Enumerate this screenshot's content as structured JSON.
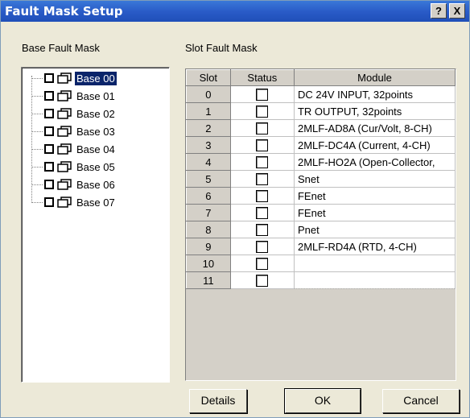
{
  "window": {
    "title": "Fault Mask Setup",
    "help_label": "?",
    "close_label": "X"
  },
  "base_panel": {
    "label": "Base Fault Mask",
    "items": [
      {
        "label": "Base 00",
        "selected": true
      },
      {
        "label": "Base 01",
        "selected": false
      },
      {
        "label": "Base 02",
        "selected": false
      },
      {
        "label": "Base 03",
        "selected": false
      },
      {
        "label": "Base 04",
        "selected": false
      },
      {
        "label": "Base 05",
        "selected": false
      },
      {
        "label": "Base 06",
        "selected": false
      },
      {
        "label": "Base 07",
        "selected": false
      }
    ]
  },
  "slot_panel": {
    "label": "Slot Fault Mask",
    "columns": [
      "Slot",
      "Status",
      "Module"
    ],
    "rows": [
      {
        "slot": "0",
        "module": "DC 24V INPUT, 32points"
      },
      {
        "slot": "1",
        "module": "TR OUTPUT, 32points"
      },
      {
        "slot": "2",
        "module": " 2MLF-AD8A (Cur/Volt, 8-CH)"
      },
      {
        "slot": "3",
        "module": " 2MLF-DC4A (Current, 4-CH)"
      },
      {
        "slot": "4",
        "module": " 2MLF-HO2A (Open-Collector,"
      },
      {
        "slot": "5",
        "module": "Snet"
      },
      {
        "slot": "6",
        "module": "FEnet"
      },
      {
        "slot": "7",
        "module": "FEnet"
      },
      {
        "slot": "8",
        "module": "Pnet"
      },
      {
        "slot": "9",
        "module": " 2MLF-RD4A (RTD, 4-CH)"
      },
      {
        "slot": "10",
        "module": ""
      },
      {
        "slot": "11",
        "module": ""
      }
    ]
  },
  "buttons": {
    "details": "Details",
    "ok": "OK",
    "cancel": "Cancel"
  }
}
